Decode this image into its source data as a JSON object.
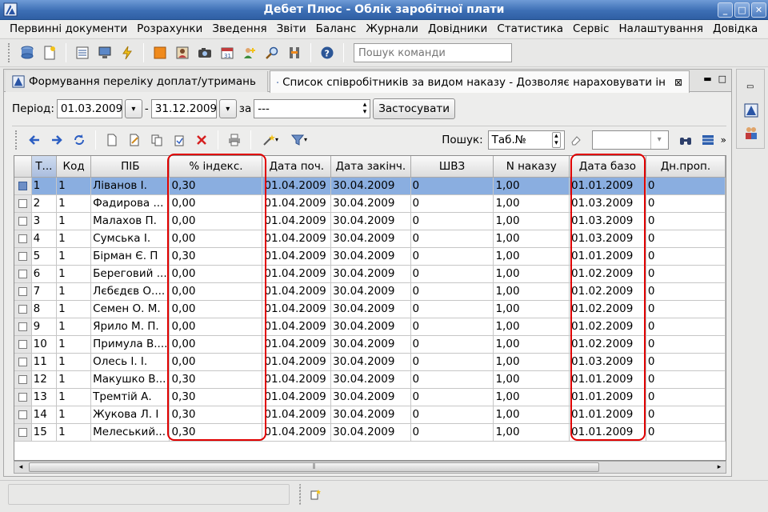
{
  "window": {
    "title": "Дебет Плюс - Облік заробітної плати",
    "controls": [
      "minimize",
      "maximize",
      "close"
    ]
  },
  "menu": [
    "Первинні документи",
    "Розрахунки",
    "Зведення",
    "Звіти",
    "Баланс",
    "Журнали",
    "Довідники",
    "Статистика",
    "Сервіс",
    "Налаштування",
    "Довідка"
  ],
  "toolbar": {
    "command_search_placeholder": "Пошук команди"
  },
  "tabs": [
    {
      "label": "Формування переліку доплат/утримань",
      "active": false
    },
    {
      "label": "Список співробітників за видом наказу - Дозволяє нараховувати ін",
      "active": true
    }
  ],
  "period": {
    "label": "Період:",
    "from": "01.03.2009",
    "dash": "-",
    "to": "31.12.2009",
    "for_label": "за",
    "for_value": "---",
    "apply_label": "Застосувати"
  },
  "gridtoolbar": {
    "search_label": "Пошук:",
    "search_field": "Таб.№",
    "more": "»"
  },
  "grid": {
    "columns": [
      "Т...",
      "Код",
      "ПІБ",
      "% індекс.",
      "Дата поч.",
      "Дата закінч.",
      "ШВЗ",
      "N наказу",
      "Дата базо",
      "Дн.проп."
    ],
    "rows": [
      [
        "1",
        "1",
        "Ліванов І.",
        "0,30",
        "01.04.2009",
        "30.04.2009",
        "0",
        "1,00",
        "01.01.2009",
        "0"
      ],
      [
        "2",
        "1",
        "Фадирова ...",
        "0,00",
        "01.04.2009",
        "30.04.2009",
        "0",
        "1,00",
        "01.03.2009",
        "0"
      ],
      [
        "3",
        "1",
        "Малахов П.",
        "0,00",
        "01.04.2009",
        "30.04.2009",
        "0",
        "1,00",
        "01.03.2009",
        "0"
      ],
      [
        "4",
        "1",
        "Сумська І.",
        "0,00",
        "01.04.2009",
        "30.04.2009",
        "0",
        "1,00",
        "01.03.2009",
        "0"
      ],
      [
        "5",
        "1",
        "Бірман Є. П",
        "0,30",
        "01.04.2009",
        "30.04.2009",
        "0",
        "1,00",
        "01.01.2009",
        "0"
      ],
      [
        "6",
        "1",
        "Береговий ...",
        "0,00",
        "01.04.2009",
        "30.04.2009",
        "0",
        "1,00",
        "01.02.2009",
        "0"
      ],
      [
        "7",
        "1",
        "Лєбєдєв О....",
        "0,00",
        "01.04.2009",
        "30.04.2009",
        "0",
        "1,00",
        "01.02.2009",
        "0"
      ],
      [
        "8",
        "1",
        "Семен О. М.",
        "0,00",
        "01.04.2009",
        "30.04.2009",
        "0",
        "1,00",
        "01.02.2009",
        "0"
      ],
      [
        "9",
        "1",
        "Ярило М. П.",
        "0,00",
        "01.04.2009",
        "30.04.2009",
        "0",
        "1,00",
        "01.02.2009",
        "0"
      ],
      [
        "10",
        "1",
        "Примула В....",
        "0,00",
        "01.04.2009",
        "30.04.2009",
        "0",
        "1,00",
        "01.02.2009",
        "0"
      ],
      [
        "11",
        "1",
        "Олесь І. І.",
        "0,00",
        "01.04.2009",
        "30.04.2009",
        "0",
        "1,00",
        "01.03.2009",
        "0"
      ],
      [
        "12",
        "1",
        "Макушко В...",
        "0,30",
        "01.04.2009",
        "30.04.2009",
        "0",
        "1,00",
        "01.01.2009",
        "0"
      ],
      [
        "13",
        "1",
        "Тремтій А.",
        "0,30",
        "01.04.2009",
        "30.04.2009",
        "0",
        "1,00",
        "01.01.2009",
        "0"
      ],
      [
        "14",
        "1",
        "Жукова Л. І",
        "0,30",
        "01.04.2009",
        "30.04.2009",
        "0",
        "1,00",
        "01.01.2009",
        "0"
      ],
      [
        "15",
        "1",
        "Мелеський...",
        "0,30",
        "01.04.2009",
        "30.04.2009",
        "0",
        "1,00",
        "01.01.2009",
        "0"
      ]
    ],
    "selected_row": 0
  },
  "colors": {
    "selection": "#8aaee0",
    "highlight": "#e00000",
    "title_bar": "#3d6fb5"
  }
}
